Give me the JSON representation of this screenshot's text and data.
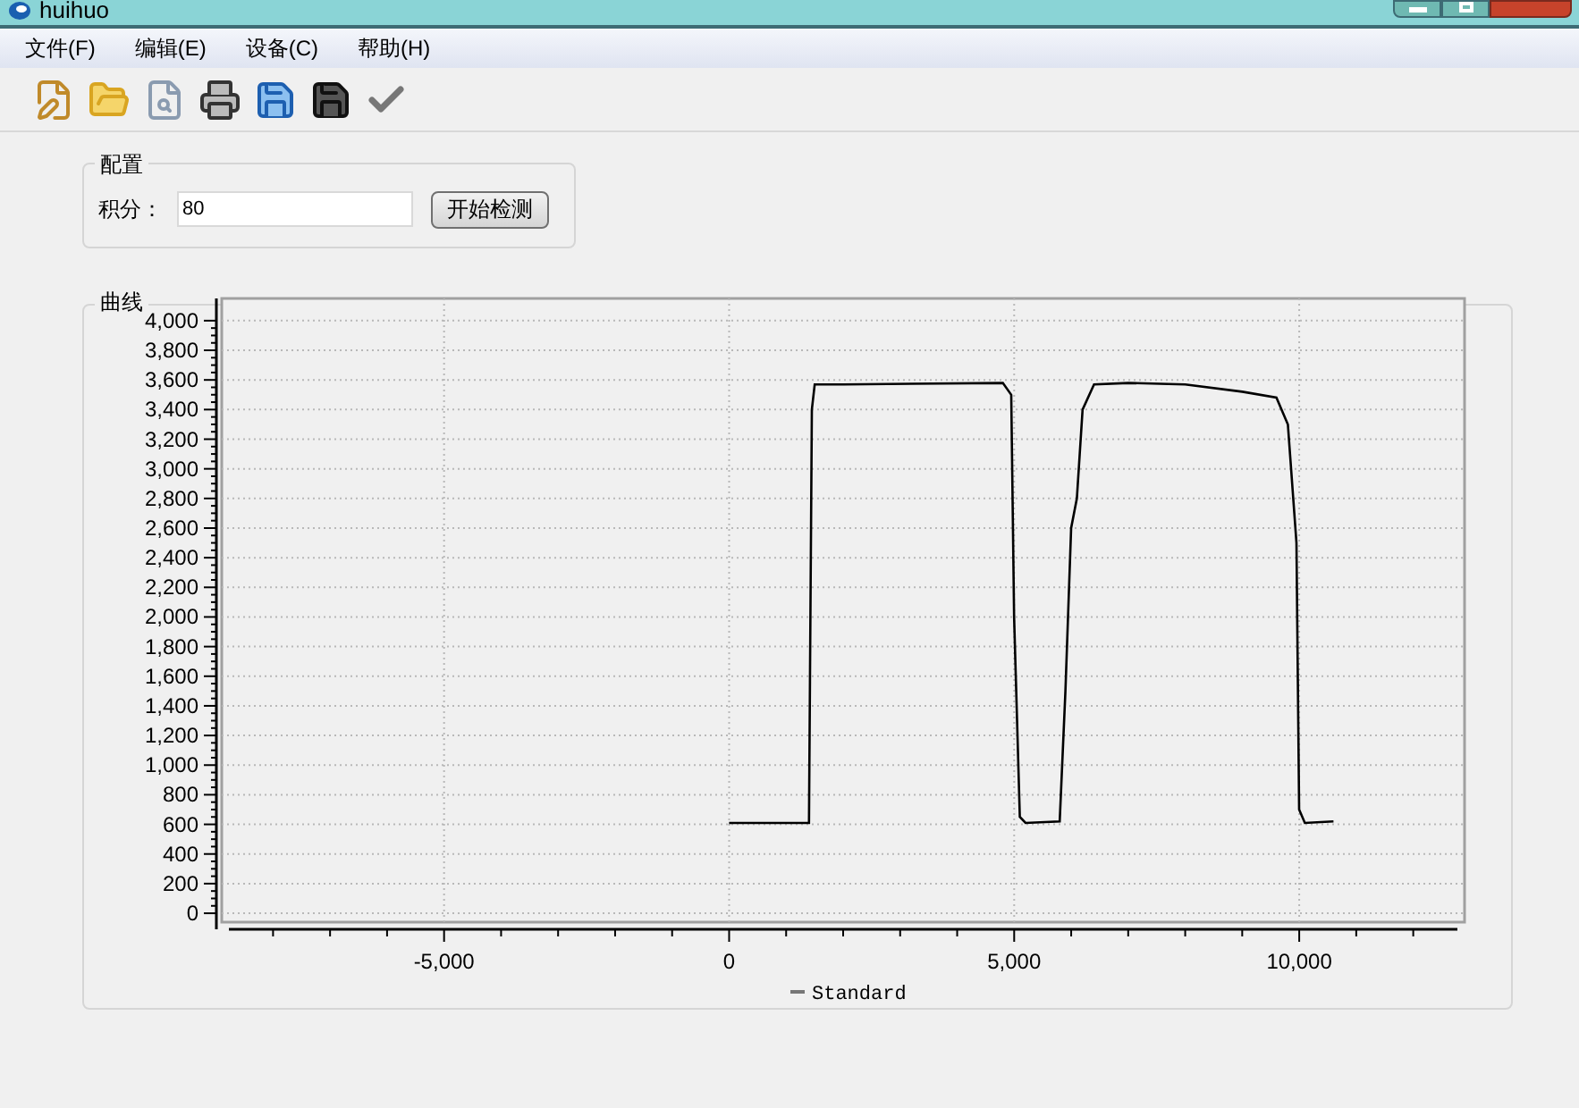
{
  "window": {
    "title": "huihuo"
  },
  "menu": [
    {
      "label": "文件(F)"
    },
    {
      "label": "编辑(E)"
    },
    {
      "label": "设备(C)"
    },
    {
      "label": "帮助(H)"
    }
  ],
  "toolbar": [
    {
      "kind": "new"
    },
    {
      "kind": "open"
    },
    {
      "kind": "preview"
    },
    {
      "kind": "print"
    },
    {
      "kind": "save_all"
    },
    {
      "kind": "save"
    },
    {
      "kind": "check"
    }
  ],
  "config": {
    "title": "配置",
    "field_label": "积分：",
    "field_value": "80",
    "button": "开始检测"
  },
  "curve": {
    "title": "曲线",
    "chart_data": {
      "type": "line",
      "grid": true,
      "xlim": [
        -8900,
        12900
      ],
      "ylim": [
        -60,
        4150
      ],
      "xticks": [
        {
          "value": -5000,
          "label": "-5,000"
        },
        {
          "value": 0,
          "label": "0"
        },
        {
          "value": 5000,
          "label": "5,000"
        },
        {
          "value": 10000,
          "label": "10,000"
        }
      ],
      "yticks": [
        {
          "value": 0,
          "label": "0"
        },
        {
          "value": 200,
          "label": "200"
        },
        {
          "value": 400,
          "label": "400"
        },
        {
          "value": 600,
          "label": "600"
        },
        {
          "value": 800,
          "label": "800"
        },
        {
          "value": 1000,
          "label": "1,000"
        },
        {
          "value": 1200,
          "label": "1,200"
        },
        {
          "value": 1400,
          "label": "1,400"
        },
        {
          "value": 1600,
          "label": "1,600"
        },
        {
          "value": 1800,
          "label": "1,800"
        },
        {
          "value": 2000,
          "label": "2,000"
        },
        {
          "value": 2200,
          "label": "2,200"
        },
        {
          "value": 2400,
          "label": "2,400"
        },
        {
          "value": 2600,
          "label": "2,600"
        },
        {
          "value": 2800,
          "label": "2,800"
        },
        {
          "value": 3000,
          "label": "3,000"
        },
        {
          "value": 3200,
          "label": "3,200"
        },
        {
          "value": 3400,
          "label": "3,400"
        },
        {
          "value": 3600,
          "label": "3,600"
        },
        {
          "value": 3800,
          "label": "3,800"
        },
        {
          "value": 4000,
          "label": "4,000"
        }
      ],
      "x": [
        0,
        1400,
        1450,
        1500,
        2000,
        4800,
        4950,
        5000,
        5100,
        5200,
        5800,
        5900,
        6000,
        6100,
        6200,
        6400,
        7000,
        8000,
        9000,
        9600,
        9800,
        9950,
        10000,
        10100,
        10600
      ],
      "series": [
        {
          "name": "Standard",
          "color": "#000000",
          "values": [
            610,
            610,
            3400,
            3570,
            3570,
            3580,
            3500,
            2000,
            650,
            610,
            620,
            1500,
            2600,
            2800,
            3400,
            3570,
            3580,
            3570,
            3520,
            3480,
            3300,
            2500,
            700,
            610,
            620
          ]
        }
      ]
    }
  }
}
